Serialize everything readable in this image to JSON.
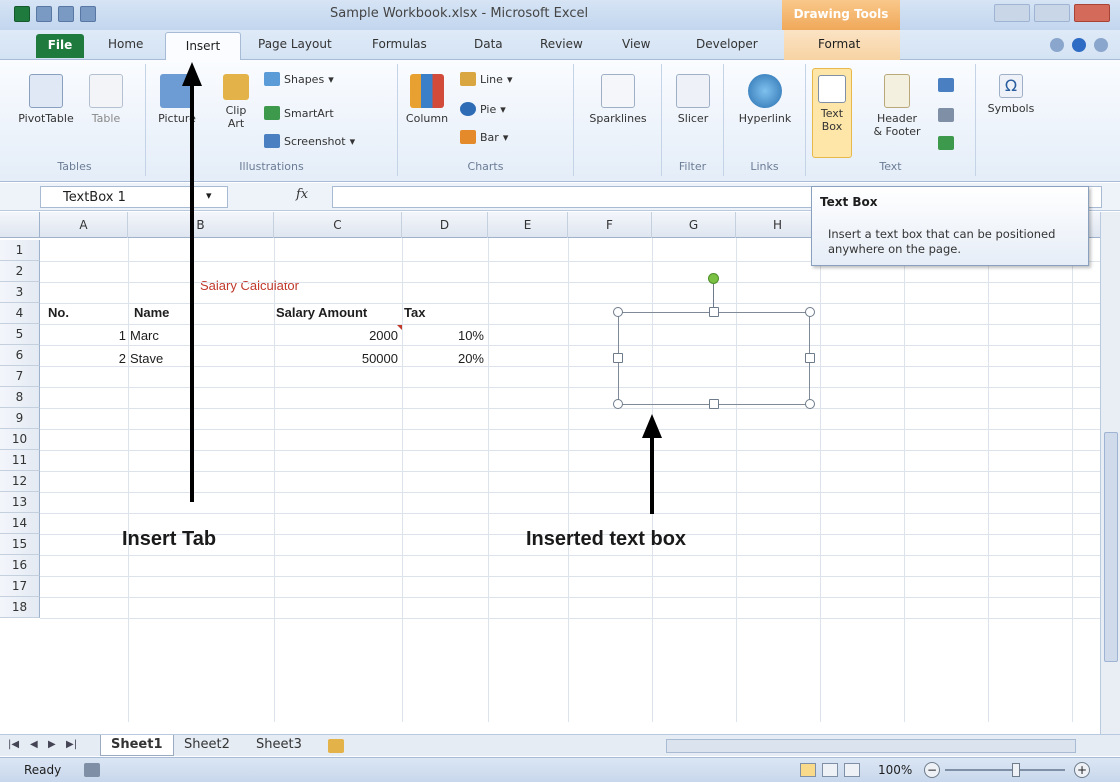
{
  "window": {
    "title": "Sample Workbook.xlsx - Microsoft Excel",
    "contextual_tab": "Drawing Tools"
  },
  "tabs": {
    "file": "File",
    "home": "Home",
    "insert": "Insert",
    "page_layout": "Page Layout",
    "formulas": "Formulas",
    "data": "Data",
    "review": "Review",
    "view": "View",
    "developer": "Developer",
    "format": "Format"
  },
  "ribbon": {
    "tables": {
      "label": "Tables",
      "pivot": "PivotTable",
      "table": "Table"
    },
    "illustrations": {
      "label": "Illustrations",
      "picture": "Picture",
      "clipart_1": "Clip",
      "clipart_2": "Art",
      "shapes": "Shapes",
      "smartart": "SmartArt",
      "screenshot": "Screenshot"
    },
    "charts": {
      "label": "Charts",
      "column": "Column",
      "line": "Line",
      "pie": "Pie",
      "bar": "Bar"
    },
    "sparklines": {
      "label": "Sparklines"
    },
    "filter": {
      "label": "Filter",
      "slicer": "Slicer"
    },
    "links": {
      "label": "Links",
      "hyperlink": "Hyperlink"
    },
    "text": {
      "label": "Text",
      "textbox_1": "Text",
      "textbox_2": "Box",
      "header_1": "Header",
      "header_2": "& Footer"
    },
    "symbols": {
      "label": "Symbols"
    }
  },
  "formula_bar": {
    "name_box": "TextBox 1",
    "fx": "fx",
    "formula": ""
  },
  "tooltip": {
    "title": "Text Box",
    "body": "Insert a text box that can be positioned anywhere on the page."
  },
  "columns": [
    "A",
    "B",
    "C",
    "D",
    "E",
    "F",
    "G",
    "H"
  ],
  "rows": [
    "1",
    "2",
    "3",
    "4",
    "5",
    "6",
    "7",
    "8",
    "9",
    "10",
    "11",
    "12",
    "13",
    "14",
    "15",
    "16",
    "17",
    "18"
  ],
  "sheet": {
    "title": "Salary Calculator",
    "headers": {
      "no": "No.",
      "name": "Name",
      "salary": "Salary Amount",
      "tax": "Tax"
    },
    "data": [
      {
        "no": "1",
        "name": "Marc",
        "salary": "2000",
        "tax": "10%"
      },
      {
        "no": "2",
        "name": "Stave",
        "salary": "50000",
        "tax": "20%"
      }
    ]
  },
  "annotations": {
    "insert_tab": "Insert Tab",
    "inserted_box": "Inserted text box"
  },
  "sheet_tabs": [
    "Sheet1",
    "Sheet2",
    "Sheet3"
  ],
  "status": {
    "ready": "Ready",
    "zoom": "100%"
  },
  "colors": {
    "title_red": "#c0392b",
    "file_green": "#1f7a3d",
    "accent_orange": "#f0a85a"
  }
}
